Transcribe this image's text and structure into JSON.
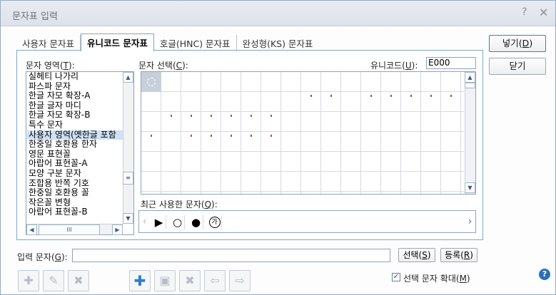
{
  "window": {
    "title": "문자표 입력",
    "help_glyph": "?",
    "close_glyph": "✕"
  },
  "tabs": [
    {
      "label": "사용자 문자표"
    },
    {
      "label": "유니코드 문자표",
      "active": true
    },
    {
      "label": "호글(HNC) 문자표"
    },
    {
      "label": "완성형(KS) 문자표"
    }
  ],
  "area_label": {
    "text": "문자 영역(",
    "key": "T",
    "end": "):"
  },
  "areas": [
    "실헤티 나가리",
    "파스파 문자",
    "한글 자모 확장-A",
    "한글 글자 마디",
    "한글 자모 확장-B",
    "특수 문자",
    "사용자 영역(옛한글 포함",
    "한중일 호환용 한자",
    "영문 표현꼴",
    "아랍어 표현꼴-A",
    "모양 구분 문자",
    "조합용 반쪽 기호",
    "한중일 호환용 꼴",
    "작은꼴 변형",
    "아랍어 표현꼴-B"
  ],
  "selected_area_index": 6,
  "char_select_label": {
    "text": "문자 선택(",
    "key": "C",
    "end": "):"
  },
  "unicode_label": {
    "text": "유니코드(",
    "key": "U",
    "end": "):"
  },
  "unicode_value": "E000",
  "recent_label": {
    "text": "최근 사용한 문자(",
    "key": "Q",
    "end": "):"
  },
  "recent_chars": [
    "▶",
    "○",
    "●",
    "가"
  ],
  "buttons": {
    "insert": {
      "text": "넣기(",
      "key": "D",
      "end": ")"
    },
    "close": "닫기",
    "select": {
      "text": "선택(",
      "key": "S",
      "end": ")"
    },
    "register": {
      "text": "등록(",
      "key": "R",
      "end": ")"
    }
  },
  "input_label": {
    "text": "입력 문자(",
    "key": "G",
    "end": "):"
  },
  "input_value": "",
  "enlarge": {
    "text": "선택 문자 확대(",
    "key": "M",
    "end": ")",
    "checked": true
  },
  "toolbar": {
    "user_set_buttons": [
      "add-set-icon",
      "rename-set-icon",
      "delete-set-icon"
    ],
    "char_buttons": [
      "plus-icon",
      "edit-icon",
      "delete-icon",
      "arrow-left-icon",
      "arrow-right-icon"
    ]
  },
  "scroll": {
    "up": "▲",
    "down": "▼",
    "left": "◀",
    "right": "▶",
    "thumb_grip": "III",
    "nav_left": "‹",
    "nav_right": "›",
    "help": "?"
  },
  "colors": {
    "accent": "#2a7fd0",
    "panel_border": "#7fa7c9",
    "selection": "#cfe1f4"
  }
}
